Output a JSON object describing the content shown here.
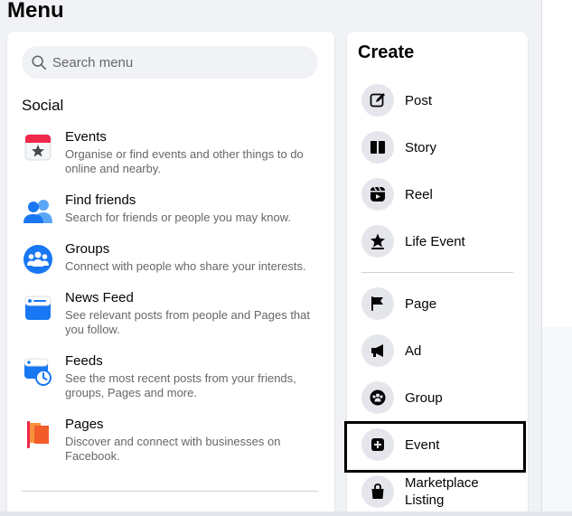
{
  "menu": {
    "title": "Menu"
  },
  "search": {
    "placeholder": "Search menu"
  },
  "social": {
    "heading": "Social",
    "items": [
      {
        "title": "Events",
        "desc": "Organise or find events and other things to do online and nearby.",
        "icon": "events-calendar-icon"
      },
      {
        "title": "Find friends",
        "desc": "Search for friends or people you may know.",
        "icon": "find-friends-icon"
      },
      {
        "title": "Groups",
        "desc": "Connect with people who share your interests.",
        "icon": "groups-icon"
      },
      {
        "title": "News Feed",
        "desc": "See relevant posts from people and Pages that you follow.",
        "icon": "news-feed-icon"
      },
      {
        "title": "Feeds",
        "desc": "See the most recent posts from your friends, groups, Pages and more.",
        "icon": "feeds-icon"
      },
      {
        "title": "Pages",
        "desc": "Discover and connect with businesses on Facebook.",
        "icon": "pages-flag-icon"
      }
    ]
  },
  "create": {
    "heading": "Create",
    "items": [
      {
        "label": "Post",
        "icon": "edit-post-icon"
      },
      {
        "label": "Story",
        "icon": "story-book-icon"
      },
      {
        "label": "Reel",
        "icon": "reel-icon"
      },
      {
        "label": "Life Event",
        "icon": "life-event-star-icon"
      },
      {
        "label": "Page",
        "icon": "page-flag-icon"
      },
      {
        "label": "Ad",
        "icon": "megaphone-icon"
      },
      {
        "label": "Group",
        "icon": "group-icon"
      },
      {
        "label": "Event",
        "icon": "event-plus-icon"
      },
      {
        "label": "Marketplace Listing",
        "icon": "shopping-bag-icon"
      }
    ]
  },
  "colors": {
    "accent": "#1877f2",
    "text_primary": "#050505",
    "text_secondary": "#65676b",
    "page_bg": "#f0f2f5",
    "panel_bg": "#ffffff",
    "highlight": "#000000"
  }
}
